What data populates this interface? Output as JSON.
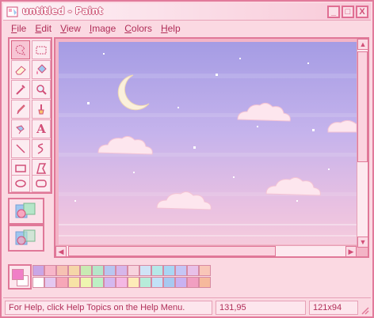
{
  "window": {
    "title": "untitled - Paint",
    "controls": {
      "minimize": "_",
      "maximize": "□",
      "close": "X"
    }
  },
  "menu": [
    "File",
    "Edit",
    "View",
    "Image",
    "Colors",
    "Help"
  ],
  "tools": [
    {
      "name": "free-form-select-icon"
    },
    {
      "name": "rect-select-icon"
    },
    {
      "name": "eraser-icon"
    },
    {
      "name": "fill-bucket-icon"
    },
    {
      "name": "color-picker-icon"
    },
    {
      "name": "magnifier-icon"
    },
    {
      "name": "pencil-icon"
    },
    {
      "name": "brush-icon"
    },
    {
      "name": "airbrush-icon"
    },
    {
      "name": "text-icon",
      "glyph": "A"
    },
    {
      "name": "line-icon"
    },
    {
      "name": "curve-icon"
    },
    {
      "name": "rectangle-icon"
    },
    {
      "name": "polygon-icon"
    },
    {
      "name": "ellipse-icon"
    },
    {
      "name": "rounded-rect-icon"
    }
  ],
  "palette": {
    "foreground": "#f07fc7",
    "background": "#ffffff",
    "row1": [
      "#c9a6e6",
      "#f7b6c9",
      "#f6c1b2",
      "#f5d6a8",
      "#c9eab3",
      "#b5e6c9",
      "#b8c6f0",
      "#d6b6ea",
      "#f7d3dd",
      "#cfe3f6",
      "#b6e8e8",
      "#a9d6f3",
      "#c5c5f5",
      "#e8c0e8",
      "#f9c6b8"
    ],
    "row2": [
      "#ffffff",
      "#e4c8f0",
      "#f7a7b8",
      "#f7e3a6",
      "#eef5b0",
      "#bdf0c4",
      "#d4b8ef",
      "#f4b8e4",
      "#fdebb8",
      "#b7ecd9",
      "#c2e2f7",
      "#a7c9f0",
      "#c9b2f2",
      "#f19fc1",
      "#f6b99c"
    ]
  },
  "status": {
    "help": "For Help, click Help Topics on the Help Menu.",
    "coords": "131,95",
    "size": "121x94"
  },
  "colors": {
    "accent": "#e07898",
    "menu_text": "#b02e58",
    "sky_top": "#a9a0e6",
    "sky_bottom": "#f3c7d8"
  }
}
